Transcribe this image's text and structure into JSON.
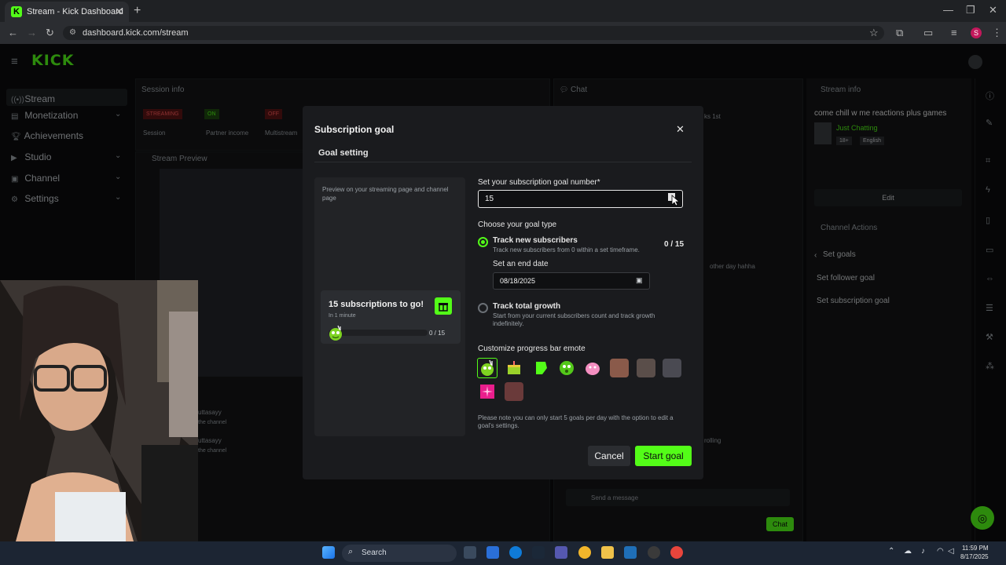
{
  "browser": {
    "tab_title": "Stream - Kick Dashboard",
    "tab_favicon": "K",
    "url": "dashboard.kick.com/stream"
  },
  "dashboard": {
    "logo": "KICK",
    "sidebar": {
      "items": [
        {
          "label": "Stream"
        },
        {
          "label": "Monetization"
        },
        {
          "label": "Achievements"
        },
        {
          "label": "Studio"
        },
        {
          "label": "Channel"
        },
        {
          "label": "Settings"
        }
      ]
    },
    "session_info": {
      "title": "Session info",
      "badges": [
        "STREAMING",
        "ON",
        "OFF"
      ],
      "labels": [
        "Session",
        "Partner income",
        "Multistream"
      ]
    },
    "stream_preview": "Stream Preview",
    "chat": {
      "title": "Chat",
      "snippets": [
        "ks 1st",
        "other day hahha",
        "uttasayy",
        "the channel",
        "uttasayy",
        "the channel",
        "rolling"
      ],
      "message_placeholder": "Send a message",
      "send_label": "Chat"
    },
    "stream_info": {
      "title": "Stream info",
      "stream_title": "come chill w me reactions plus games",
      "category": "Just Chatting",
      "tags": [
        "18+",
        "English"
      ],
      "edit_label": "Edit"
    },
    "channel_actions": {
      "title": "Channel Actions",
      "back_label": "Set goals",
      "items": [
        "Set follower goal",
        "Set subscription goal"
      ]
    }
  },
  "modal": {
    "title": "Subscription goal",
    "tab": "Goal setting",
    "preview_text": "Preview on your streaming page and channel page",
    "preview_card": {
      "title": "15 subscriptions to go!",
      "subtitle": "In 1 minute",
      "count": "0 / 15"
    },
    "goal_number_label": "Set your subscription goal number*",
    "goal_number_value": "15",
    "goal_type_label": "Choose your goal type",
    "options": [
      {
        "title": "Track new subscribers",
        "description": "Track new subscribers from 0 within a set timeframe.",
        "count": "0 / 15",
        "selected": true
      },
      {
        "title": "Track total growth",
        "description": "Start from your current subscribers count and track growth indefinitely.",
        "selected": false
      }
    ],
    "end_date_label": "Set an end date",
    "end_date_value": "08/18/2025",
    "emote_label": "Customize progress bar emote",
    "note": "Please note you can only start 5 goals per day with the option to edit a goal's settings.",
    "cancel_label": "Cancel",
    "start_label": "Start goal",
    "accent": "#53fc18"
  },
  "taskbar": {
    "search_placeholder": "Search",
    "time": "11:59 PM",
    "date": "8/17/2025"
  }
}
